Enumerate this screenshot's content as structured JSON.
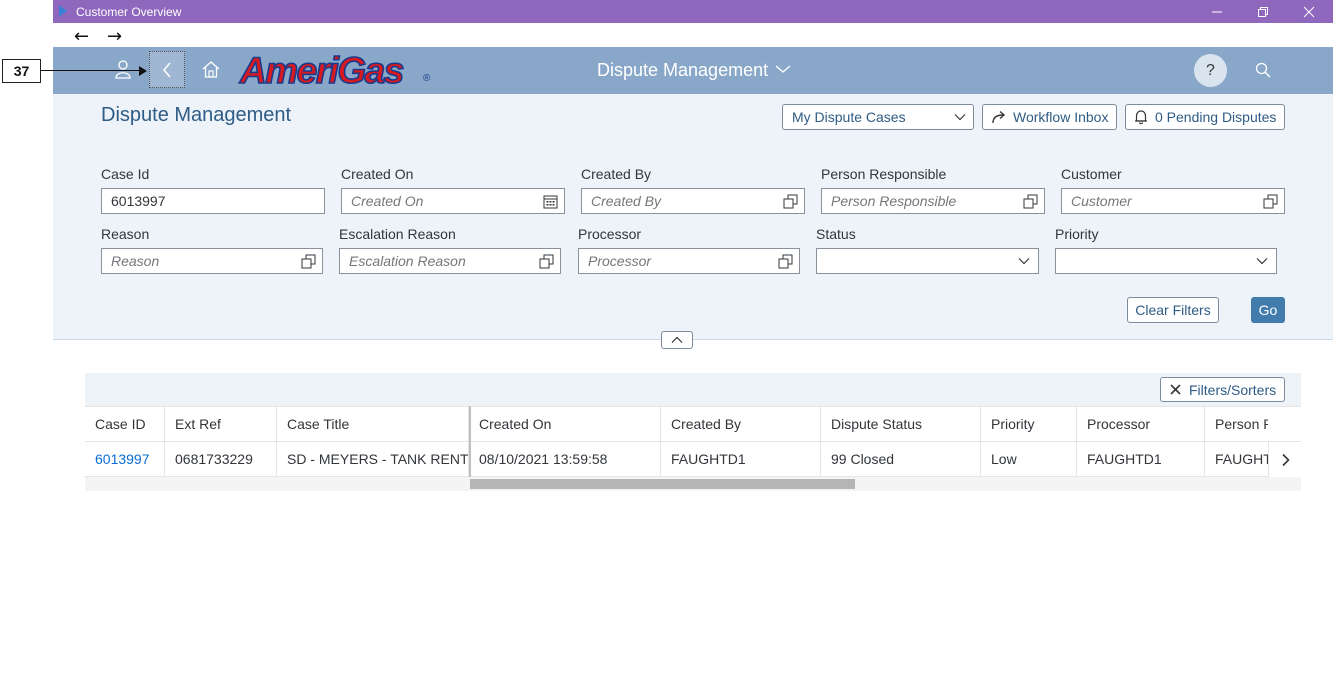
{
  "window": {
    "title": "Customer Overview",
    "controls": [
      "minimize-icon",
      "restore-icon",
      "close-icon"
    ]
  },
  "nav": {
    "back_glyph": "←",
    "forward_glyph": "→"
  },
  "callout": {
    "label": "37"
  },
  "shell": {
    "logo": "AmeriGas",
    "logo_reg": "®",
    "title": "Dispute Management",
    "help_label": "?"
  },
  "page": {
    "title": "Dispute Management",
    "variant_select": "My Dispute Cases",
    "workflow_inbox": "Workflow Inbox",
    "pending_disputes": "0 Pending Disputes"
  },
  "filters": {
    "case_id": {
      "label": "Case Id",
      "value": "6013997"
    },
    "created_on": {
      "label": "Created On",
      "placeholder": "Created On"
    },
    "created_by": {
      "label": "Created By",
      "placeholder": "Created By"
    },
    "person_responsible": {
      "label": "Person Responsible",
      "placeholder": "Person Responsible"
    },
    "customer": {
      "label": "Customer",
      "placeholder": "Customer"
    },
    "reason": {
      "label": "Reason",
      "placeholder": "Reason"
    },
    "escalation_reason": {
      "label": "Escalation Reason",
      "placeholder": "Escalation Reason"
    },
    "processor": {
      "label": "Processor",
      "placeholder": "Processor"
    },
    "status": {
      "label": "Status",
      "value": ""
    },
    "priority": {
      "label": "Priority",
      "value": ""
    },
    "clear_label": "Clear Filters",
    "go_label": "Go"
  },
  "table": {
    "filters_sorters": "Filters/Sorters",
    "columns": [
      "Case ID",
      "Ext Ref",
      "Case Title",
      "Created On",
      "Created By",
      "Dispute Status",
      "Priority",
      "Processor",
      "Person R"
    ],
    "rows": [
      [
        "6013997",
        "0681733229",
        "SD - MEYERS - TANK RENT",
        "08/10/2021 13:59:58",
        "FAUGHTD1",
        "99 Closed",
        "Low",
        "FAUGHTD1",
        "FAUGHT"
      ]
    ]
  },
  "colors": {
    "titlebar": "#8f67bd",
    "shellbar": "#89a8c9",
    "filter_bg": "#edf3f8",
    "link": "#0a6ed1",
    "emphasized_button": "#427cac"
  }
}
